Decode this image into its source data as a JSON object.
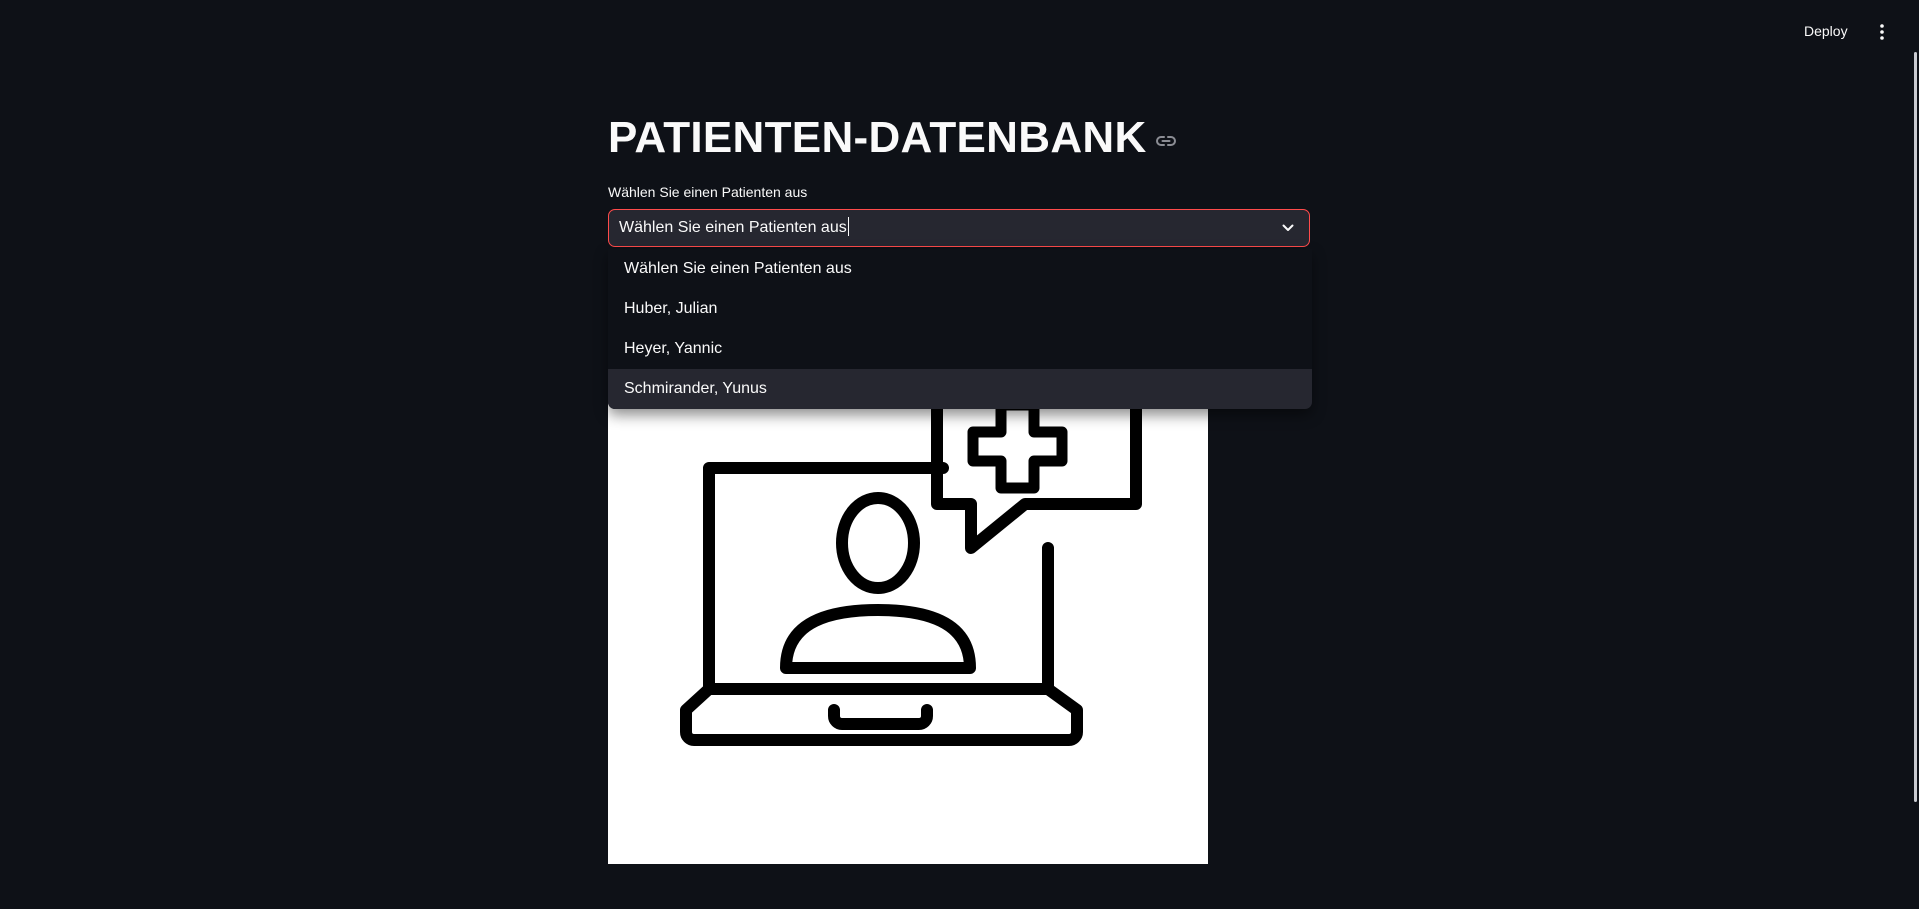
{
  "header": {
    "deploy_label": "Deploy",
    "menu_icon": "vertical-ellipsis-icon"
  },
  "main": {
    "title": "PATIENTEN-DATENBANK",
    "title_link_icon": "link-icon",
    "select": {
      "label": "Wählen Sie einen Patienten aus",
      "value": "Wählen Sie einen Patienten aus",
      "accent_color": "#ff4b4b",
      "options": [
        "Wählen Sie einen Patienten aus",
        "Huber, Julian",
        "Heyer, Yannic",
        "Schmirander, Yunus"
      ],
      "highlighted_option": "Schmirander, Yunus"
    },
    "image": {
      "icon": "telemedicine-laptop-patient-icon"
    }
  },
  "colors": {
    "background": "#0e1117",
    "input_background": "#262730",
    "text": "#fafafa"
  }
}
